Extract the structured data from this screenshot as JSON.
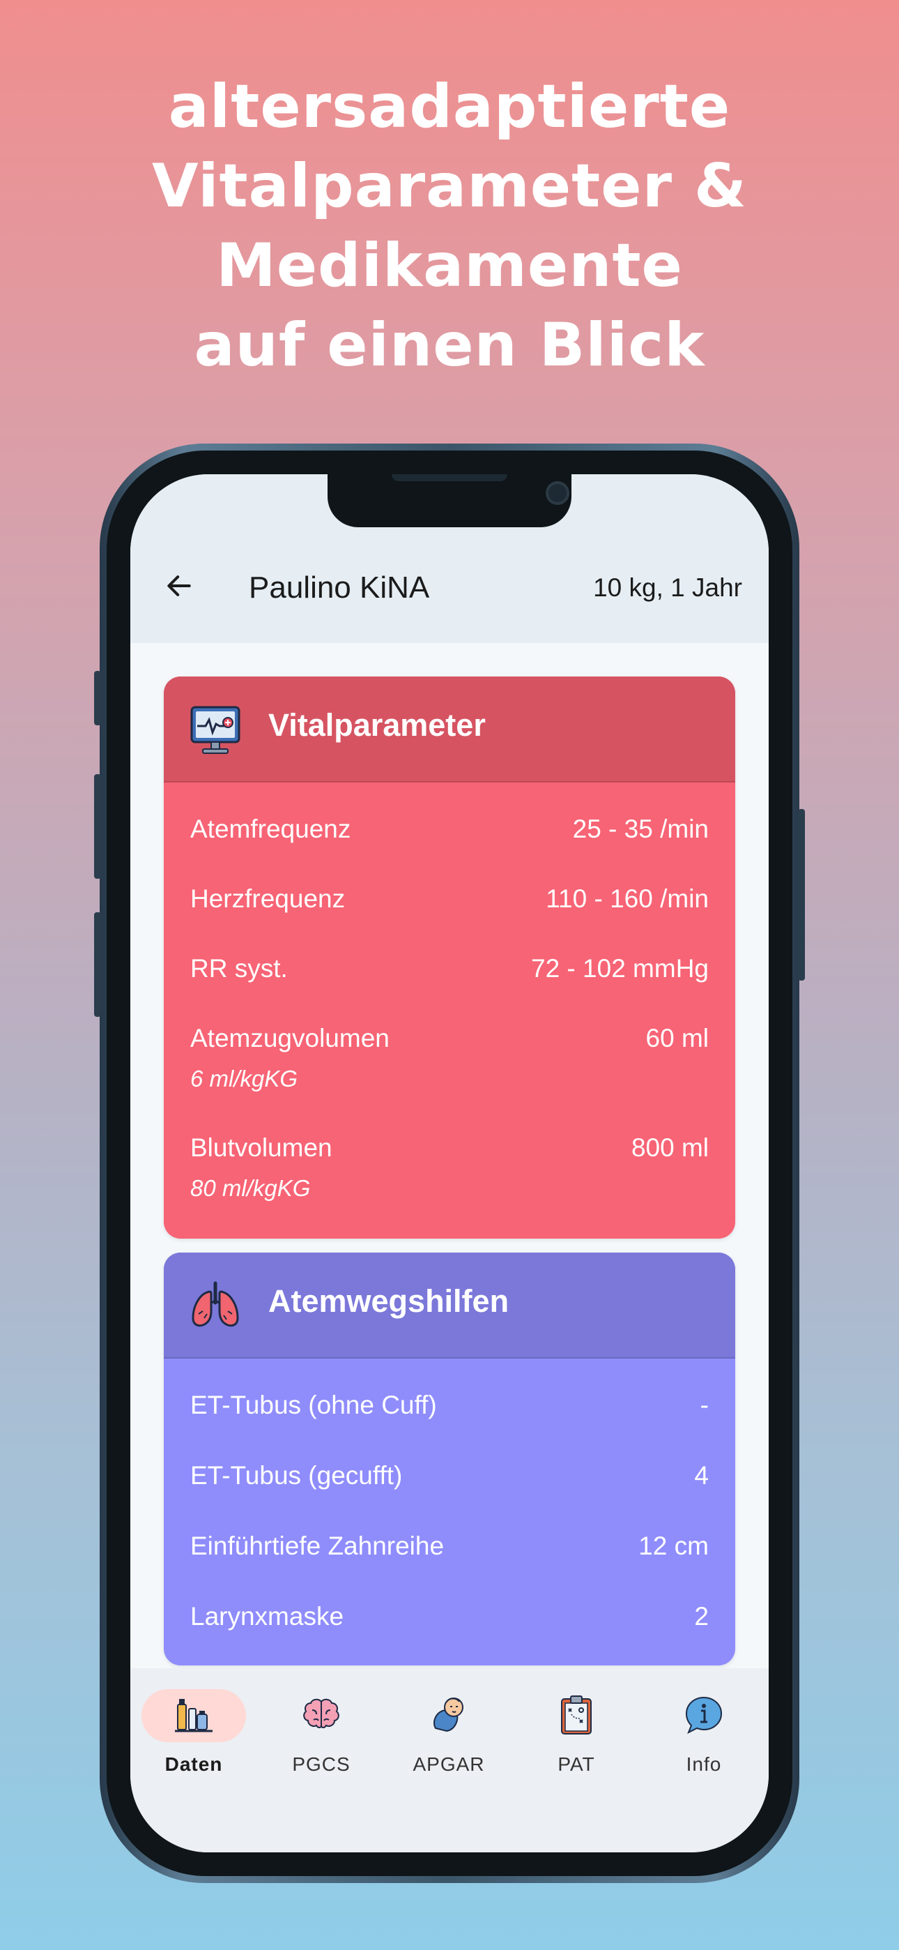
{
  "headline": {
    "line1": "altersadaptierte",
    "line2": "Vitalparameter &",
    "line3": "Medikamente",
    "line4": "auf einen Blick"
  },
  "appbar": {
    "title": "Paulino KiNA",
    "meta": "10 kg, 1 Jahr",
    "back_icon": "arrow-left-icon"
  },
  "vital": {
    "title": "Vitalparameter",
    "icon": "monitor-icon",
    "rows": [
      {
        "label": "Atemfrequenz",
        "value": "25 - 35 /min",
        "sub": ""
      },
      {
        "label": "Herzfrequenz",
        "value": "110 - 160 /min",
        "sub": ""
      },
      {
        "label": "RR syst.",
        "value": "72 - 102 mmHg",
        "sub": ""
      },
      {
        "label": "Atemzugvolumen",
        "value": "60 ml",
        "sub": "6 ml/kgKG"
      },
      {
        "label": "Blutvolumen",
        "value": "800 ml",
        "sub": "80 ml/kgKG"
      }
    ]
  },
  "airway": {
    "title": "Atemwegshilfen",
    "icon": "lungs-icon",
    "rows": [
      {
        "label": "ET-Tubus (ohne Cuff)",
        "value": "-"
      },
      {
        "label": "ET-Tubus (gecufft)",
        "value": "4"
      },
      {
        "label": "Einführtiefe Zahnreihe",
        "value": "12 cm"
      },
      {
        "label": "Larynxmaske",
        "value": "2"
      }
    ]
  },
  "nav": {
    "items": [
      {
        "label": "Daten",
        "icon": "medication-vials-icon",
        "active": true
      },
      {
        "label": "PGCS",
        "icon": "brain-icon",
        "active": false
      },
      {
        "label": "APGAR",
        "icon": "baby-icon",
        "active": false
      },
      {
        "label": "PAT",
        "icon": "clipboard-icon",
        "active": false
      },
      {
        "label": "Info",
        "icon": "info-icon",
        "active": false
      }
    ]
  },
  "colors": {
    "vital_body": "#f76475",
    "vital_head": "#d65462",
    "airway_body": "#8f8dfb",
    "airway_head": "#7b78da",
    "nav_active_pill": "#ffd9d5"
  }
}
